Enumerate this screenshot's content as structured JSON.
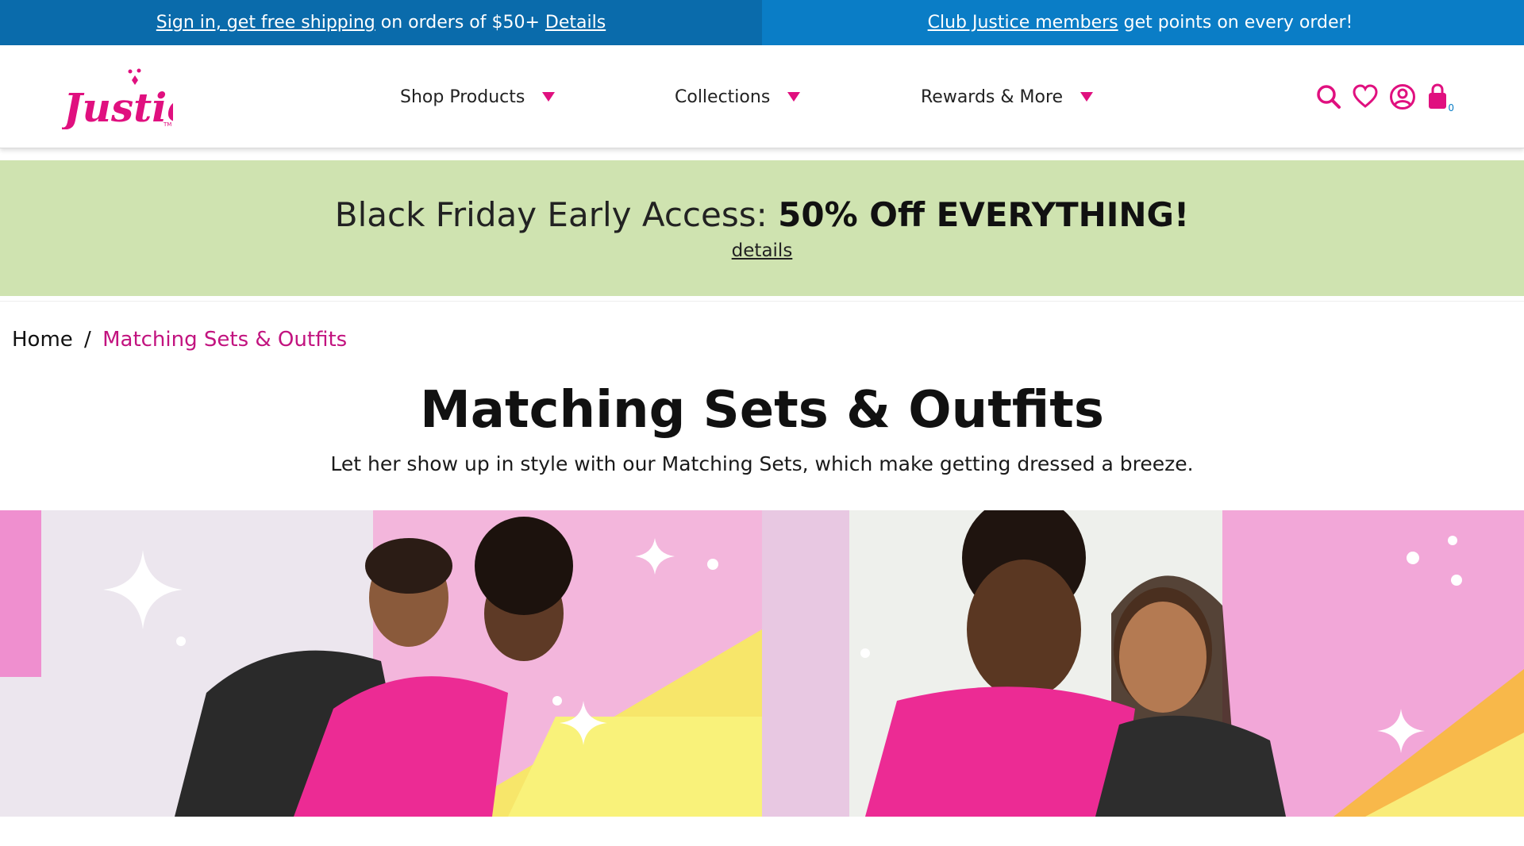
{
  "promo": {
    "left": {
      "link1": "Sign in, get free shipping",
      "text": "on orders of $50+",
      "link2": "Details"
    },
    "right": {
      "link": "Club Justice members",
      "text": "get points on every order!"
    }
  },
  "header": {
    "logo_text": "Justice",
    "nav": [
      {
        "label": "Shop Products"
      },
      {
        "label": "Collections"
      },
      {
        "label": "Rewards & More"
      }
    ],
    "icons": [
      "search-icon",
      "heart-icon",
      "account-icon",
      "bag-icon"
    ],
    "cart_count": "0"
  },
  "banner": {
    "headline_prefix": "Black Friday Early Access:",
    "headline_bold": "50% Off EVERYTHING!",
    "details_link": "details",
    "bg_color": "#cfe3b0"
  },
  "breadcrumb": {
    "home": "Home",
    "separator": "/",
    "current": "Matching Sets & Outfits"
  },
  "page": {
    "title": "Matching Sets & Outfits",
    "subtitle": "Let her show up in style with our Matching Sets, which make getting dressed a breeze."
  },
  "colors": {
    "brand_pink": "#e0107f",
    "promo_blue_left": "#0a6bab",
    "promo_blue_right": "#0a7dc6",
    "breadcrumb_current": "#c2137f"
  }
}
